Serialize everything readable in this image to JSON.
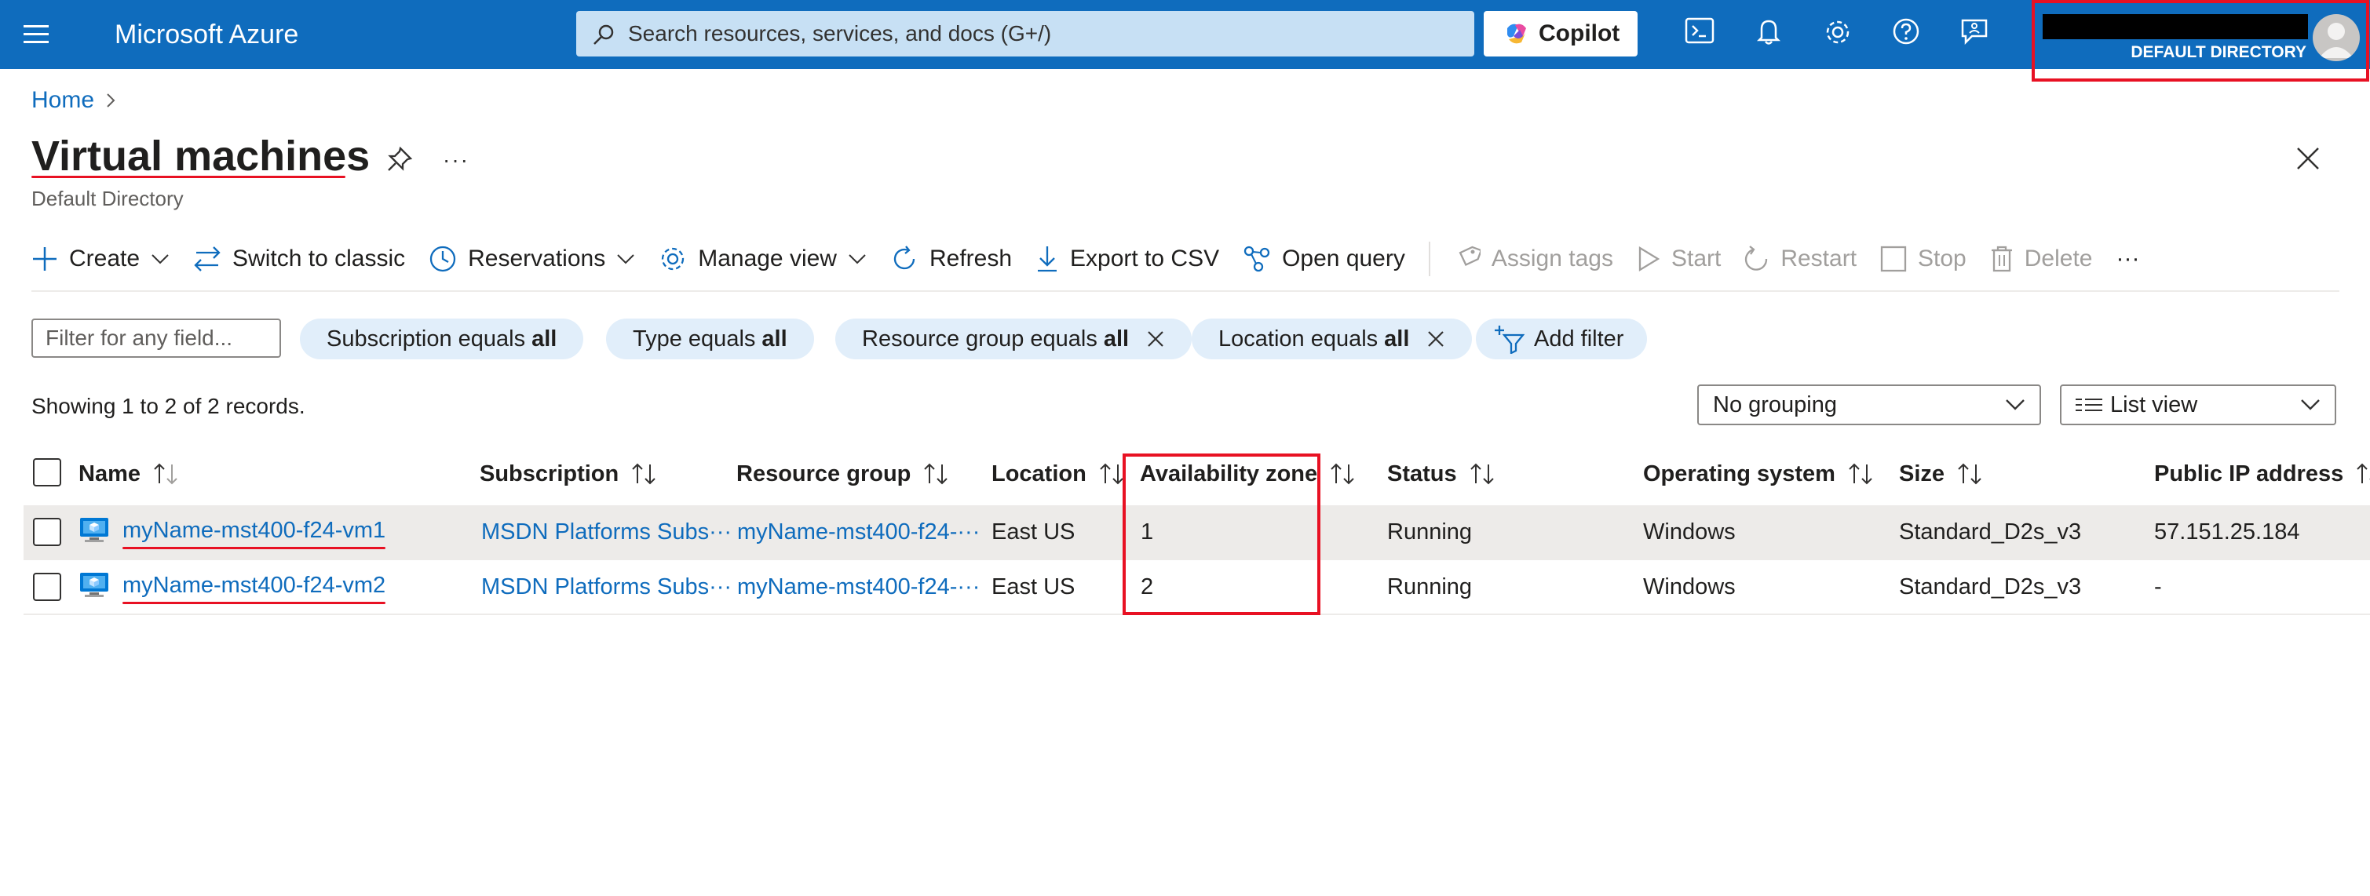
{
  "header": {
    "brand": "Microsoft Azure",
    "search_placeholder": "Search resources, services, and docs (G+/)",
    "copilot_label": "Copilot",
    "directory_label": "DEFAULT DIRECTORY"
  },
  "breadcrumb": {
    "home": "Home"
  },
  "page": {
    "title": "Virtual machines",
    "subtitle": "Default Directory"
  },
  "toolbar": {
    "create": "Create",
    "switch_classic": "Switch to classic",
    "reservations": "Reservations",
    "manage_view": "Manage view",
    "refresh": "Refresh",
    "export_csv": "Export to CSV",
    "open_query": "Open query",
    "assign_tags": "Assign tags",
    "start": "Start",
    "restart": "Restart",
    "stop": "Stop",
    "delete": "Delete",
    "more": "···"
  },
  "filters": {
    "input_placeholder": "Filter for any field...",
    "pills": [
      {
        "label": "Subscription equals",
        "value": "all"
      },
      {
        "label": "Type equals",
        "value": "all"
      },
      {
        "label": "Resource group equals",
        "value": "all"
      },
      {
        "label": "Location equals",
        "value": "all"
      }
    ],
    "add_filter": "Add filter"
  },
  "records_text": "Showing 1 to 2 of 2 records.",
  "grouping": "No grouping",
  "view_mode": "List view",
  "columns": [
    "Name",
    "Subscription",
    "Resource group",
    "Location",
    "Availability zone",
    "Status",
    "Operating system",
    "Size",
    "Public IP address"
  ],
  "rows": [
    {
      "name": "myName-mst400-f24-vm1",
      "subscription": "MSDN Platforms Subs···",
      "resource_group": "myName-mst400-f24-···",
      "location": "East US",
      "zone": "1",
      "status": "Running",
      "os": "Windows",
      "size": "Standard_D2s_v3",
      "public_ip": "57.151.25.184"
    },
    {
      "name": "myName-mst400-f24-vm2",
      "subscription": "MSDN Platforms Subs···",
      "resource_group": "myName-mst400-f24-···",
      "location": "East US",
      "zone": "2",
      "status": "Running",
      "os": "Windows",
      "size": "Standard_D2s_v3",
      "public_ip": "-"
    }
  ],
  "colors": {
    "header_blue": "#0f6cbd",
    "link_blue": "#0f6cbd",
    "annotation_red": "#e81123"
  }
}
